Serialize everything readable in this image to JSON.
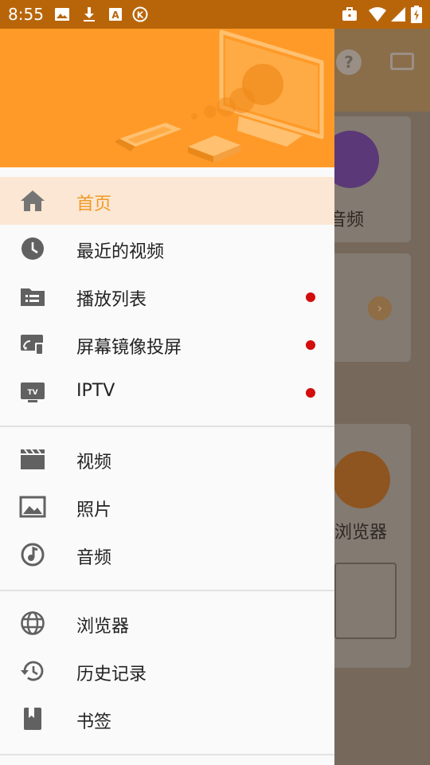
{
  "status_bar": {
    "time": "8:55",
    "left_icons": [
      "image-icon",
      "download-icon",
      "a-box-icon",
      "k-circle-icon"
    ],
    "right_icons": [
      "briefcase-icon",
      "wifi-icon",
      "signal-icon",
      "battery-icon"
    ]
  },
  "background": {
    "audio_label": "音频",
    "browser_label": "浏览器"
  },
  "drawer": {
    "sections": [
      [
        {
          "label": "首页",
          "icon": "home-icon",
          "active": true,
          "badge": false
        },
        {
          "label": "最近的视频",
          "icon": "clock-icon",
          "active": false,
          "badge": false
        },
        {
          "label": "播放列表",
          "icon": "playlist-folder-icon",
          "active": false,
          "badge": true
        },
        {
          "label": "屏幕镜像投屏",
          "icon": "screen-mirror-icon",
          "active": false,
          "badge": true
        },
        {
          "label": "IPTV",
          "icon": "tv-icon",
          "active": false,
          "badge": true
        }
      ],
      [
        {
          "label": "视频",
          "icon": "video-clapper-icon",
          "active": false,
          "badge": false
        },
        {
          "label": "照片",
          "icon": "photo-icon",
          "active": false,
          "badge": false
        },
        {
          "label": "音频",
          "icon": "music-icon",
          "active": false,
          "badge": false
        }
      ],
      [
        {
          "label": "浏览器",
          "icon": "globe-icon",
          "active": false,
          "badge": false
        },
        {
          "label": "历史记录",
          "icon": "history-icon",
          "active": false,
          "badge": false
        },
        {
          "label": "书签",
          "icon": "bookmark-icon",
          "active": false,
          "badge": false
        }
      ]
    ]
  },
  "colors": {
    "accent": "#f29a24",
    "header": "#ff9a28",
    "badge": "#d30c0c",
    "active_bg": "#fbe7d4"
  }
}
